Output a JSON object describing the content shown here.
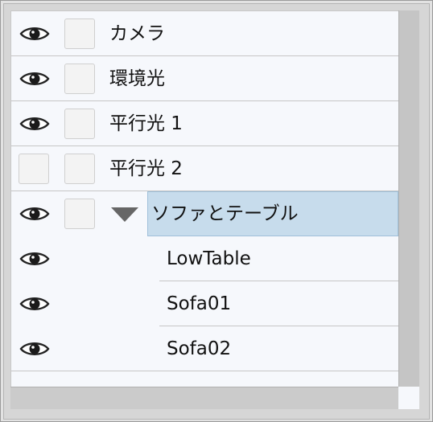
{
  "tree": {
    "items": [
      {
        "label": "カメラ",
        "visible": true,
        "child": false
      },
      {
        "label": "環境光",
        "visible": true,
        "child": false
      },
      {
        "label": "平行光 1",
        "visible": true,
        "child": false
      },
      {
        "label": "平行光 2",
        "visible": false,
        "child": false
      },
      {
        "label": "ソファとテーブル",
        "visible": true,
        "child": false,
        "expanded": true,
        "selected": true
      },
      {
        "label": "LowTable",
        "visible": true,
        "child": true
      },
      {
        "label": "Sofa01",
        "visible": true,
        "child": true
      },
      {
        "label": "Sofa02",
        "visible": true,
        "child": true
      }
    ]
  },
  "icons": {
    "visibility": "eye-icon",
    "expander": "triangle-down-icon"
  },
  "colors": {
    "selection": "#c7dcec",
    "background": "#f6f8fc"
  }
}
